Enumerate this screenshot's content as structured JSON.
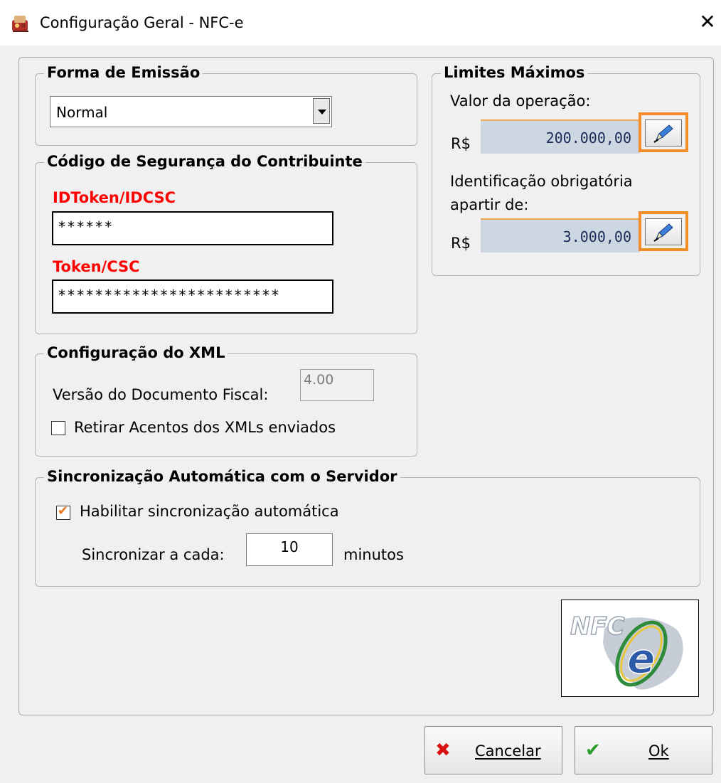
{
  "window": {
    "title": "Configuração Geral - NFC-e"
  },
  "forma_emissao": {
    "legend": "Forma de Emissão",
    "selected": "Normal"
  },
  "codigo_seguranca": {
    "legend": "Código de Segurança do Contribuinte",
    "idtoken_label": "IDToken/IDCSC",
    "idtoken_value": "******",
    "token_label": "Token/CSC",
    "token_value": "************************"
  },
  "limites": {
    "legend": "Limites Máximos",
    "valor_label": "Valor da operação:",
    "currency": "R$",
    "valor_value": "200.000,00",
    "ident_label_line1": "Identificação obrigatória",
    "ident_label_line2": "apartir de:",
    "ident_value": "3.000,00"
  },
  "xml": {
    "legend": "Configuração do XML",
    "versao_label": "Versão do Documento Fiscal:",
    "versao_value": "4.00",
    "retirar_label": "Retirar Acentos dos XMLs enviados",
    "retirar_checked": false
  },
  "sync": {
    "legend": "Sincronização Automática com o Servidor",
    "habilitar_label": "Habilitar sincronização automática",
    "habilitar_checked": true,
    "cada_label": "Sincronizar a cada:",
    "cada_value": "10",
    "unit": "minutos"
  },
  "logo": {
    "text": "NFC",
    "letter": "e"
  },
  "buttons": {
    "cancel": "Cancelar",
    "ok": "Ok"
  },
  "colors": {
    "highlight": "#f28c28",
    "required_label": "#ff0000",
    "check": "#e8741c",
    "cancel_icon": "#d81010",
    "ok_icon": "#2a9a2a"
  },
  "icons": {
    "close": "close-icon",
    "edit": "pen-icon",
    "cancel": "x-icon",
    "ok": "checkmark-icon"
  }
}
